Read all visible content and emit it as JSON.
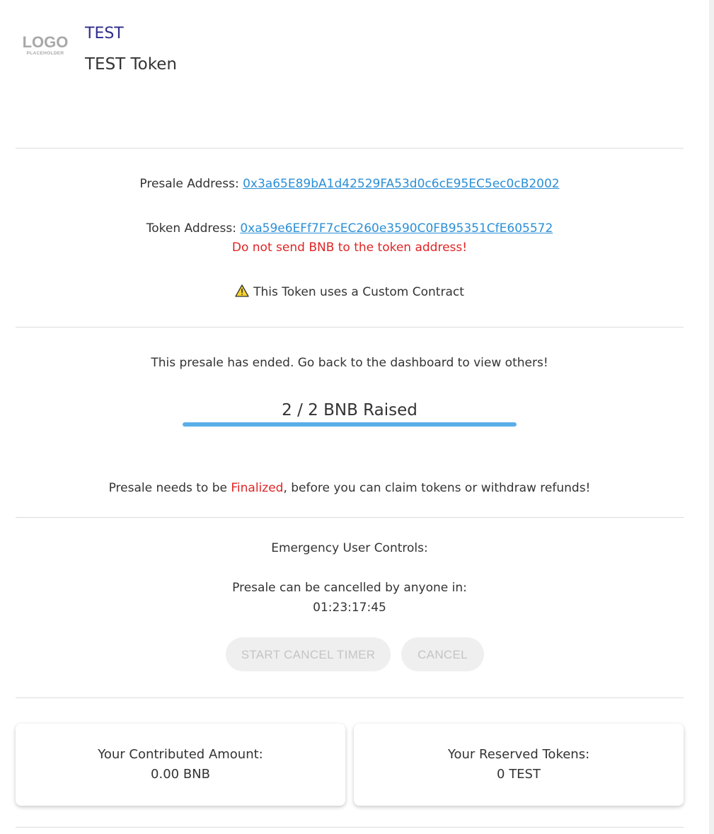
{
  "header": {
    "logo_main": "LOGO",
    "logo_sub": "PLACEHOLDER",
    "token_symbol": "TEST",
    "token_name": "TEST Token"
  },
  "addresses": {
    "presale_label": "Presale Address: ",
    "presale_address": "0x3a65E89bA1d42529FA53d0c6cE95EC5ec0cB2002",
    "token_label": "Token Address: ",
    "token_address": "0xa59e6EFf7F7cEC260e3590C0FB95351CfE605572",
    "token_warning": "Do not send BNB to the token address!",
    "custom_contract_notice": "This Token uses a Custom Contract"
  },
  "status": {
    "ended_message": "This presale has ended. Go back to the dashboard to view others!",
    "raised_text": "2 / 2 BNB Raised",
    "progress_fraction": 1.0,
    "finalize_prefix": "Presale needs to be ",
    "finalize_word": "Finalized",
    "finalize_suffix": ", before you can claim tokens or withdraw refunds!"
  },
  "emergency": {
    "title": "Emergency User Controls:",
    "cancel_info": "Presale can be cancelled by anyone in:",
    "countdown": "01:23:17:45",
    "start_cancel_timer_label": "START CANCEL TIMER",
    "cancel_label": "CANCEL"
  },
  "cards": {
    "contributed_label": "Your Contributed Amount:",
    "contributed_value": "0.00 BNB",
    "reserved_label": "Your Reserved Tokens:",
    "reserved_value": "0 TEST"
  },
  "colors": {
    "accent_link": "#2b8fd6",
    "warning_red": "#e02424",
    "symbol_purple": "#2e2b8c",
    "progress_blue": "#5aaee8"
  }
}
